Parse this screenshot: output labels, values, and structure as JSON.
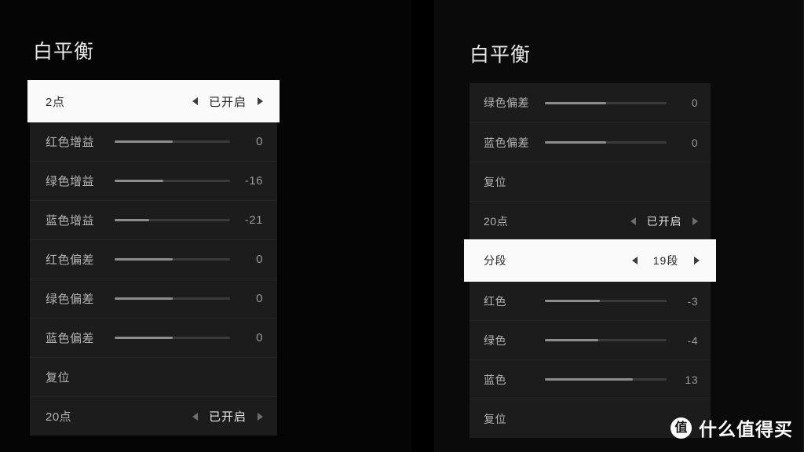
{
  "colors": {
    "background": "#000000",
    "panel_left_bg": "#050505",
    "panel_right_bg": "#0a0a0a",
    "row_bg": "#1c1c1c",
    "row_divider": "#262626",
    "selected_bg": "#fafafa",
    "selected_text": "#2a2a2a",
    "label_text": "#b4b4b4",
    "value_text": "#9a9a9a",
    "slider_track": "#3a3a3a",
    "slider_fill": "#8d8d8d",
    "arrow": "#6e6e6e"
  },
  "left_panel": {
    "title": "白平衡",
    "rows": [
      {
        "type": "stepper",
        "selected": true,
        "label": "2点",
        "value": "已开启",
        "prev_icon": "chevron-left-icon",
        "next_icon": "chevron-right-icon"
      },
      {
        "type": "slider",
        "label": "红色增益",
        "value": "0",
        "fill_percent": 50
      },
      {
        "type": "slider",
        "label": "绿色增益",
        "value": "-16",
        "fill_percent": 42
      },
      {
        "type": "slider",
        "label": "蓝色增益",
        "value": "-21",
        "fill_percent": 30
      },
      {
        "type": "slider",
        "label": "红色偏差",
        "value": "0",
        "fill_percent": 50
      },
      {
        "type": "slider",
        "label": "绿色偏差",
        "value": "0",
        "fill_percent": 50
      },
      {
        "type": "slider",
        "label": "蓝色偏差",
        "value": "0",
        "fill_percent": 50
      },
      {
        "type": "action",
        "label": "复位"
      },
      {
        "type": "stepper",
        "selected": false,
        "label": "20点",
        "value": "已开启",
        "prev_icon": "chevron-left-icon",
        "next_icon": "chevron-right-icon"
      }
    ]
  },
  "right_panel": {
    "title": "白平衡",
    "rows": [
      {
        "type": "slider",
        "label": "绿色偏差",
        "value": "0",
        "fill_percent": 50
      },
      {
        "type": "slider",
        "label": "蓝色偏差",
        "value": "0",
        "fill_percent": 50
      },
      {
        "type": "action",
        "label": "复位"
      },
      {
        "type": "stepper",
        "selected": false,
        "label": "20点",
        "value": "已开启",
        "prev_icon": "chevron-left-icon",
        "next_icon": "chevron-right-icon"
      },
      {
        "type": "stepper",
        "selected": true,
        "label": "分段",
        "value": "19段",
        "prev_icon": "chevron-left-icon",
        "next_icon": "chevron-right-icon"
      },
      {
        "type": "slider",
        "label": "红色",
        "value": "-3",
        "fill_percent": 45
      },
      {
        "type": "slider",
        "label": "绿色",
        "value": "-4",
        "fill_percent": 44
      },
      {
        "type": "slider",
        "label": "蓝色",
        "value": "13",
        "fill_percent": 72
      },
      {
        "type": "action",
        "label": "复位"
      }
    ]
  },
  "watermark": {
    "badge": "值",
    "text": "什么值得买"
  }
}
